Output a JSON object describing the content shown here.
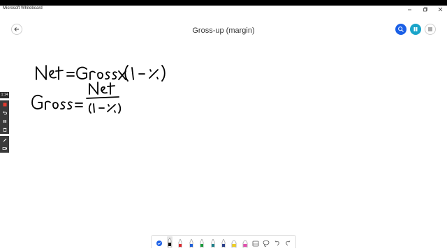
{
  "window": {
    "app_title": "Microsoft Whiteboard",
    "controls": [
      "minimize-icon",
      "restore-icon",
      "close-icon"
    ]
  },
  "header": {
    "board_title": "Gross-up (margin)",
    "back_icon": "arrow-left-icon",
    "right_buttons": [
      {
        "name": "search-button",
        "icon": "search-icon",
        "color": "#1a5fe6"
      },
      {
        "name": "share-button",
        "icon": "share-icon",
        "color": "#19a4c9"
      },
      {
        "name": "menu-button",
        "icon": "menu-icon",
        "color": "#ffffff"
      }
    ]
  },
  "recording": {
    "timer": "1:14",
    "controls": [
      "record-icon",
      "undo-icon",
      "pause-icon",
      "trash-icon"
    ],
    "extra": [
      "pen-icon",
      "camera-icon"
    ]
  },
  "canvas": {
    "equations": [
      "Net = Gross X (1 - %)",
      "Gross = Net / (1 - %)"
    ]
  },
  "toolbar": {
    "tools": [
      {
        "name": "select-tool",
        "icon": "check-circle-icon",
        "color": "#1a5fe6"
      },
      {
        "name": "pen-black",
        "icon": "pen-icon",
        "color": "#111111",
        "active": true
      },
      {
        "name": "pen-red",
        "icon": "pen-icon",
        "color": "#d8282e"
      },
      {
        "name": "pen-blue",
        "icon": "pen-icon",
        "color": "#1f5fd6"
      },
      {
        "name": "pen-green",
        "icon": "pen-icon",
        "color": "#1a9a3c"
      },
      {
        "name": "pen-teal",
        "icon": "pen-icon",
        "color": "#1e7f8a"
      },
      {
        "name": "pen-navy",
        "icon": "pen-icon",
        "color": "#2a3f8a"
      },
      {
        "name": "highlighter-yellow",
        "icon": "highlighter-icon",
        "color": "#f2d11c"
      },
      {
        "name": "highlighter-pink",
        "icon": "highlighter-icon",
        "color": "#e44fb0"
      },
      {
        "name": "eraser-tool",
        "icon": "eraser-icon",
        "color": "#555555"
      },
      {
        "name": "lasso-tool",
        "icon": "lasso-icon",
        "color": "#555555"
      },
      {
        "name": "undo-tool",
        "icon": "undo-icon",
        "color": "#555555"
      },
      {
        "name": "redo-tool",
        "icon": "redo-icon",
        "color": "#555555"
      }
    ]
  }
}
